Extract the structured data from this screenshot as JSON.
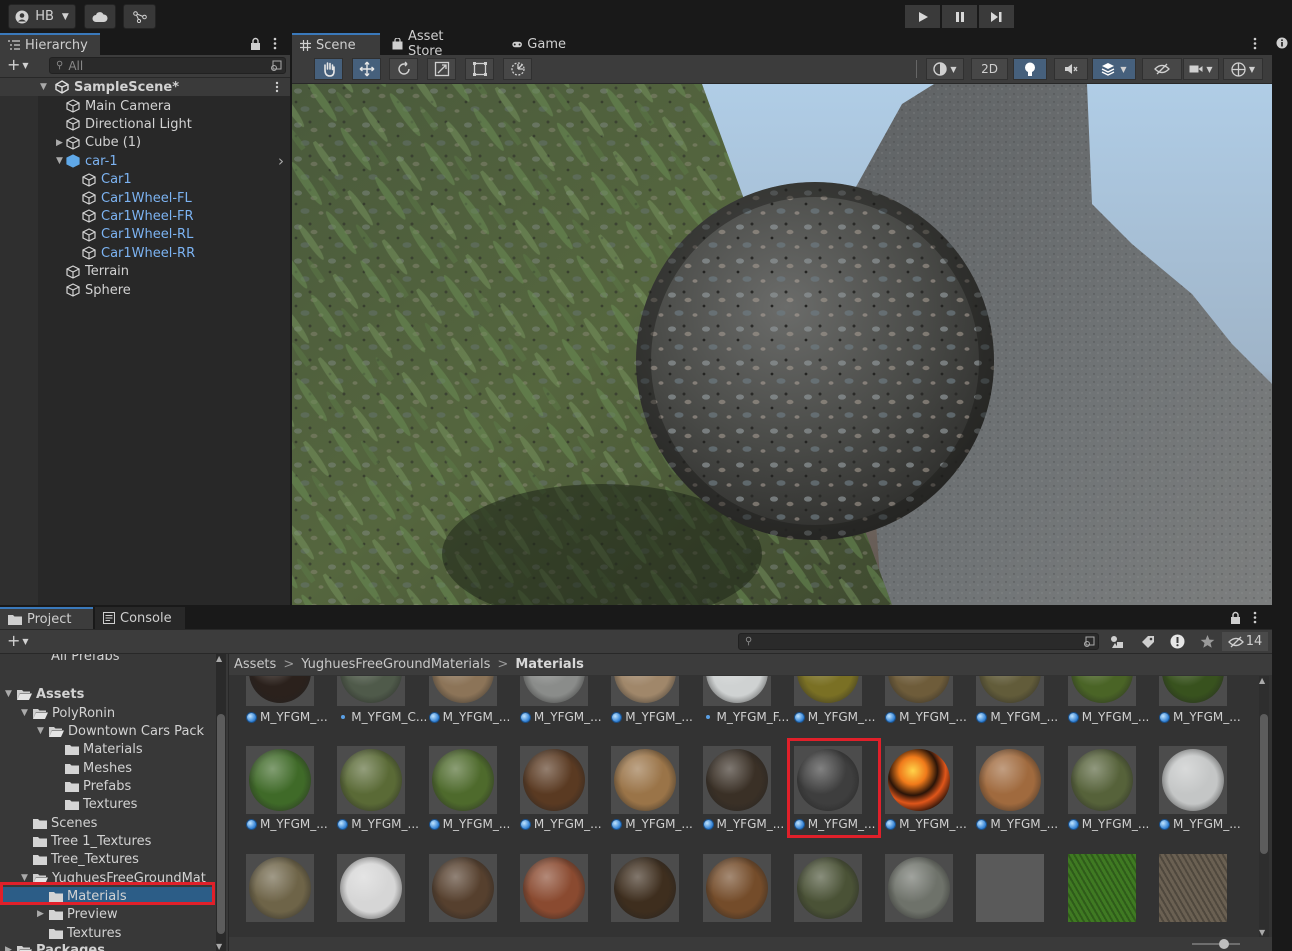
{
  "toolbar": {
    "account_label": "HB",
    "icons": [
      "account-icon",
      "cloud-icon",
      "collab-icon",
      "play-icon",
      "pause-icon",
      "step-icon"
    ]
  },
  "hierarchy": {
    "tab_label": "Hierarchy",
    "search_placeholder": "All",
    "scene_name": "SampleScene*",
    "items": [
      {
        "label": "Main Camera",
        "depth": 1,
        "expander": "",
        "prefab": false
      },
      {
        "label": "Directional Light",
        "depth": 1,
        "expander": "",
        "prefab": false
      },
      {
        "label": "Cube (1)",
        "depth": 1,
        "expander": "collapsed",
        "prefab": false
      },
      {
        "label": "car-1",
        "depth": 1,
        "expander": "expanded",
        "prefab": true
      },
      {
        "label": "Car1",
        "depth": 2,
        "expander": "",
        "prefab": true
      },
      {
        "label": "Car1Wheel-FL",
        "depth": 2,
        "expander": "",
        "prefab": true
      },
      {
        "label": "Car1Wheel-FR",
        "depth": 2,
        "expander": "",
        "prefab": true
      },
      {
        "label": "Car1Wheel-RL",
        "depth": 2,
        "expander": "",
        "prefab": true
      },
      {
        "label": "Car1Wheel-RR",
        "depth": 2,
        "expander": "",
        "prefab": true
      },
      {
        "label": "Terrain",
        "depth": 1,
        "expander": "",
        "prefab": false
      },
      {
        "label": "Sphere",
        "depth": 1,
        "expander": "",
        "prefab": false
      }
    ]
  },
  "scene": {
    "tabs": [
      {
        "label": "Scene",
        "icon": "grid-icon",
        "active": true
      },
      {
        "label": "Asset Store",
        "icon": "bag-icon",
        "active": false
      },
      {
        "label": "Game",
        "icon": "gamepad-icon",
        "active": false
      }
    ],
    "tools": [
      "hand-tool-icon",
      "move-tool-icon",
      "rotate-tool-icon",
      "scale-tool-icon",
      "rect-tool-icon",
      "transform-tool-icon"
    ],
    "mode_2d_label": "2D"
  },
  "project": {
    "tabs": [
      {
        "label": "Project",
        "icon": "folder-icon",
        "active": true
      },
      {
        "label": "Console",
        "icon": "console-icon",
        "active": false
      }
    ],
    "hidden_count": "14",
    "breadcrumb": [
      "Assets",
      "YughuesFreeGroundMaterials",
      "Materials"
    ],
    "tree": [
      {
        "label": "All Prefabs",
        "depth": 1,
        "expander": "",
        "bold": false,
        "partial": true
      },
      {
        "label": "Assets",
        "depth": 0,
        "expander": "expanded",
        "bold": true,
        "open": true
      },
      {
        "label": "PolyRonin",
        "depth": 1,
        "expander": "expanded",
        "bold": false,
        "open": true
      },
      {
        "label": "Downtown Cars Pack",
        "depth": 2,
        "expander": "expanded",
        "bold": false,
        "open": true
      },
      {
        "label": "Materials",
        "depth": 3,
        "expander": "",
        "bold": false
      },
      {
        "label": "Meshes",
        "depth": 3,
        "expander": "",
        "bold": false
      },
      {
        "label": "Prefabs",
        "depth": 3,
        "expander": "",
        "bold": false
      },
      {
        "label": "Textures",
        "depth": 3,
        "expander": "",
        "bold": false
      },
      {
        "label": "Scenes",
        "depth": 1,
        "expander": "",
        "bold": false
      },
      {
        "label": "Tree 1_Textures",
        "depth": 1,
        "expander": "",
        "bold": false
      },
      {
        "label": "Tree_Textures",
        "depth": 1,
        "expander": "",
        "bold": false
      },
      {
        "label": "YughuesFreeGroundMat",
        "depth": 1,
        "expander": "expanded",
        "bold": false,
        "open": true
      },
      {
        "label": "Materials",
        "depth": 2,
        "expander": "",
        "bold": false,
        "selected": true
      },
      {
        "label": "Preview",
        "depth": 2,
        "expander": "collapsed",
        "bold": false
      },
      {
        "label": "Textures",
        "depth": 2,
        "expander": "",
        "bold": false
      },
      {
        "label": "Packages",
        "depth": 0,
        "expander": "collapsed",
        "bold": true,
        "open": true
      }
    ],
    "assets_row1": [
      {
        "label": "M_YFGM_...",
        "icon": "material",
        "color": "#2b211c"
      },
      {
        "label": "M_YFGM_C...",
        "icon": "dot",
        "color": "#4f5a4a"
      },
      {
        "label": "M_YFGM_...",
        "icon": "material",
        "color": "#8c7458"
      },
      {
        "label": "M_YFGM_...",
        "icon": "material",
        "color": "#8a8c8a"
      },
      {
        "label": "M_YFGM_...",
        "icon": "material",
        "color": "#a0876a"
      },
      {
        "label": "M_YFGM_F...",
        "icon": "dot",
        "color": "#cfd2d2"
      },
      {
        "label": "M_YFGM_...",
        "icon": "material",
        "color": "#7a7024"
      },
      {
        "label": "M_YFGM_...",
        "icon": "material",
        "color": "#6e5c3a"
      },
      {
        "label": "M_YFGM_...",
        "icon": "material",
        "color": "#625c3a"
      },
      {
        "label": "M_YFGM_...",
        "icon": "material",
        "color": "#4a6426"
      },
      {
        "label": "M_YFGM_...",
        "icon": "material",
        "color": "#38521e"
      }
    ],
    "assets_row2": [
      {
        "label": "M_YFGM_...",
        "icon": "material",
        "color": "#3f6a28"
      },
      {
        "label": "M_YFGM_...",
        "icon": "material",
        "color": "#5a6a36"
      },
      {
        "label": "M_YFGM_...",
        "icon": "material",
        "color": "#4e6a2c"
      },
      {
        "label": "M_YFGM_...",
        "icon": "material",
        "color": "#5a3a22"
      },
      {
        "label": "M_YFGM_...",
        "icon": "material",
        "color": "#9a7448"
      },
      {
        "label": "M_YFGM_...",
        "icon": "material",
        "color": "#3a3026"
      },
      {
        "label": "M_YFGM_...",
        "icon": "material",
        "color": "#3e3e3e",
        "highlighted": true
      },
      {
        "label": "M_YFGM_...",
        "icon": "material",
        "color": "#d8661a"
      },
      {
        "label": "M_YFGM_...",
        "icon": "material",
        "color": "#a06a3e"
      },
      {
        "label": "M_YFGM_...",
        "icon": "material",
        "color": "#56623a"
      },
      {
        "label": "M_YFGM_...",
        "icon": "material",
        "color": "#c4c6c6"
      }
    ],
    "assets_row3": [
      {
        "color": "#6e6448",
        "kind": "ball"
      },
      {
        "color": "#d6d6d6",
        "kind": "ball"
      },
      {
        "color": "#56402e",
        "kind": "ball"
      },
      {
        "color": "#8a4a30",
        "kind": "ball"
      },
      {
        "color": "#3e2e1e",
        "kind": "ball"
      },
      {
        "color": "#744c2a",
        "kind": "ball"
      },
      {
        "color": "#4a5236",
        "kind": "ball"
      },
      {
        "color": "#6e726a",
        "kind": "ball"
      },
      {
        "color": "#5a5a5a",
        "kind": "square"
      },
      {
        "color": "#3f7a22",
        "kind": "texture"
      },
      {
        "color": "#6a6052",
        "kind": "texture"
      }
    ]
  }
}
